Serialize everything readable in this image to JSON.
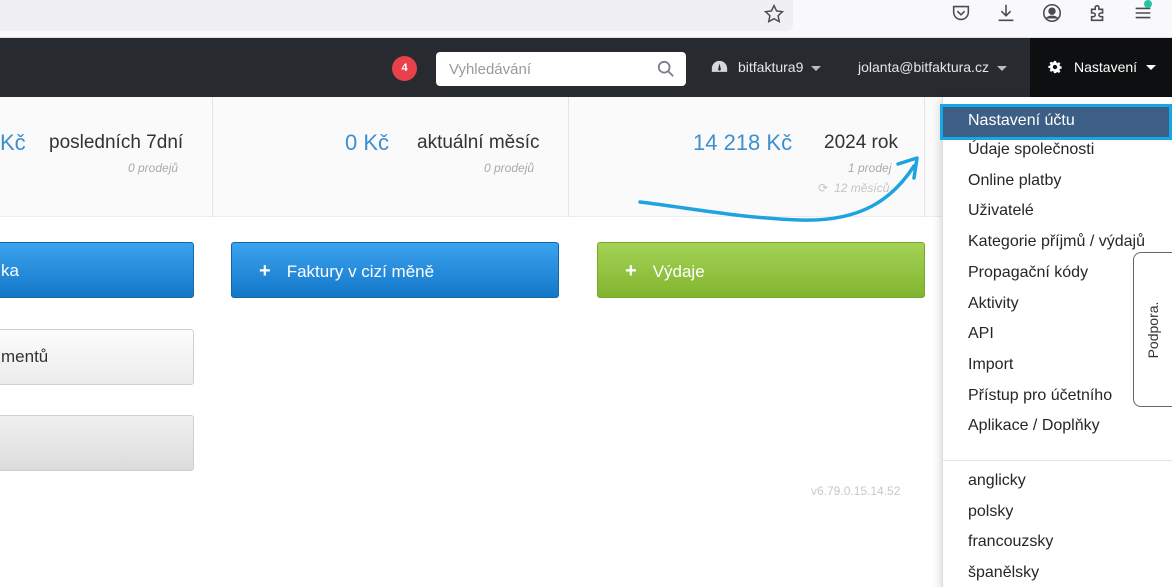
{
  "browser": {
    "icons": [
      "star-icon",
      "pocket-icon",
      "download-icon",
      "account-icon",
      "extensions-icon",
      "menu-icon"
    ]
  },
  "navbar": {
    "notification_count": "4",
    "search_placeholder": "Vyhledávání",
    "company": "bitfaktura9",
    "user_email": "jolanta@bitfaktura.cz",
    "settings_label": "Nastavení"
  },
  "stats": [
    {
      "amount": "Kč",
      "period": "posledních 7dní",
      "count": "0 prodejů"
    },
    {
      "amount": "0 Kč",
      "period": "aktuální měsíc",
      "count": "0 prodejů"
    },
    {
      "amount": "14 218 Kč",
      "period": "2024 rok",
      "count": "1 prodej",
      "extra": "12 měsíců"
    }
  ],
  "buttons": {
    "invoice_partial": "ka",
    "foreign_invoices": "Faktury v cizí měně",
    "expenses": "Výdaje",
    "documents_partial": "mentů"
  },
  "version": "v6.79.0.15.14.52",
  "dropdown": {
    "active": "Nastavení účtu",
    "items": [
      "Údaje společnosti",
      "Online platby",
      "Uživatelé",
      "Kategorie příjmů / výdajů",
      "Propagační kódy",
      "Aktivity",
      "API",
      "Import",
      "Přístup pro účetního",
      "Aplikace / Doplňky"
    ],
    "languages": [
      "anglicky",
      "polsky",
      "francouzsky",
      "španělsky"
    ]
  },
  "support_label": "Podpora.",
  "colors": {
    "navbar": "#272b30",
    "accent_blue": "#3d8fce",
    "button_blue": "#1a86d8",
    "button_green": "#8fc33c",
    "badge_red": "#e9414b",
    "active_menu": "#3e5f85",
    "highlight": "#16a7e8"
  }
}
